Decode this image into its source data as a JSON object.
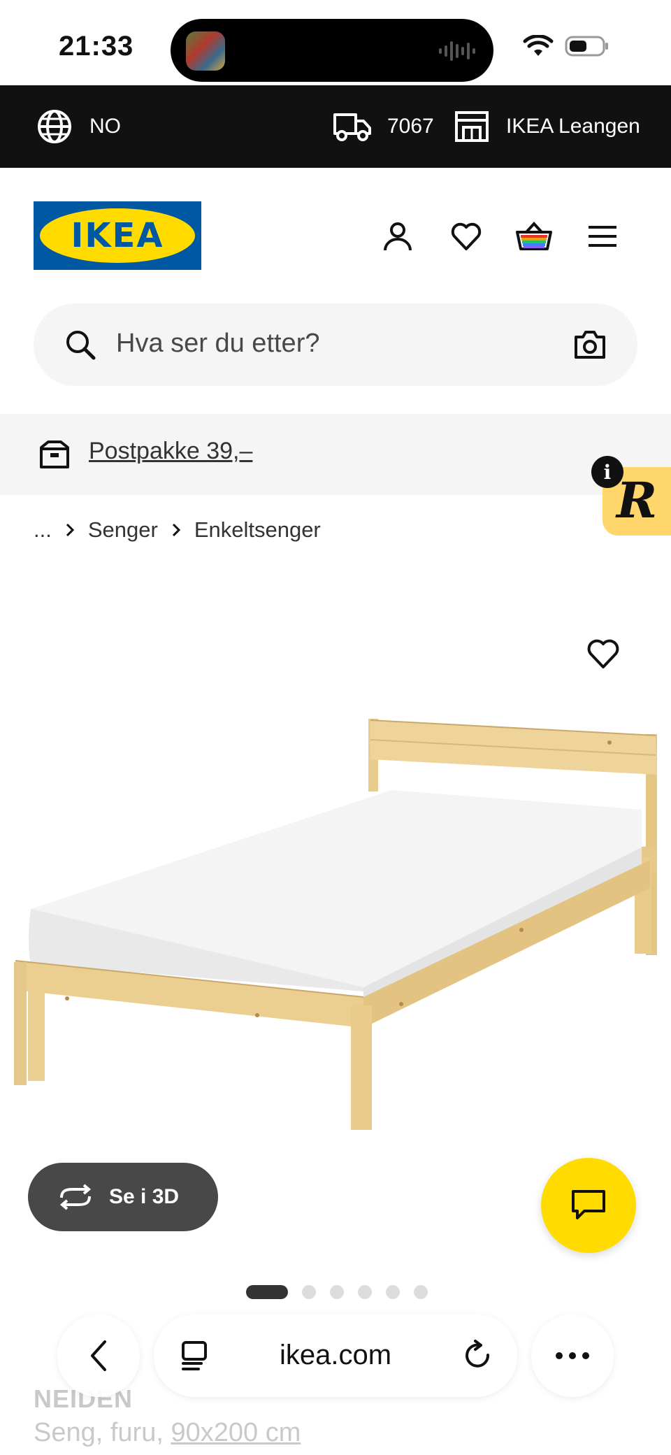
{
  "status_bar": {
    "time": "21:33"
  },
  "top_bar": {
    "language": "NO",
    "postcode": "7067",
    "store": "IKEA Leangen"
  },
  "header": {
    "logo_text": "IKEA",
    "icons": [
      "user-icon",
      "heart-icon",
      "basket-icon",
      "menu-icon"
    ]
  },
  "search": {
    "placeholder": "Hva ser du etter?"
  },
  "banner": {
    "link_text": "Postpakke 39,–"
  },
  "badge": {
    "letter": "R",
    "info": "i"
  },
  "breadcrumb": {
    "ellipsis": "...",
    "items": [
      "Senger",
      "Enkeltsenger"
    ]
  },
  "product": {
    "image_alt": "NEIDEN bed frame in pine with white mattress",
    "view_3d_label": "Se i 3D",
    "carousel": {
      "count": 6,
      "active": 0
    },
    "name": "NEIDEN",
    "desc_prefix": "Seng, furu, ",
    "size": "90x200 cm"
  },
  "browser": {
    "url": "ikea.com"
  },
  "colors": {
    "ikea_blue": "#0058a3",
    "ikea_yellow": "#ffdb00",
    "badge_yellow": "#ffd66b",
    "dark_bar": "#111111"
  }
}
